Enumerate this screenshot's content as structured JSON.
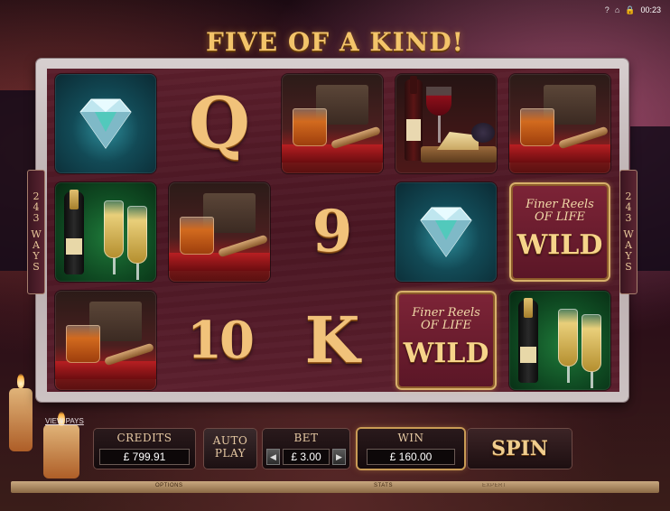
{
  "status_bar": {
    "time": "00:23"
  },
  "headline": "FIVE OF A KIND!",
  "ways": {
    "digits": [
      "2",
      "4",
      "3"
    ],
    "letters": [
      "W",
      "A",
      "Y",
      "S"
    ]
  },
  "reels": {
    "symbols": {
      "q": "Q",
      "nine": "9",
      "ten": "10",
      "k": "K"
    },
    "wild": {
      "subtitle_line1": "Finer Reels",
      "subtitle_line2": "OF LIFE",
      "word": "WILD"
    }
  },
  "controls": {
    "view_pays": "VIEW PAYS",
    "credits_label": "CREDITS",
    "credits_value": "£ 799.91",
    "autoplay_line1": "AUTO",
    "autoplay_line2": "PLAY",
    "bet_label": "BET",
    "bet_value": "£ 3.00",
    "bet_decrease": "◀",
    "bet_increase": "▶",
    "win_label": "WIN",
    "win_value": "£ 160.00",
    "spin_label": "SPIN"
  },
  "footer": {
    "options": "OPTIONS",
    "stats": "STATS",
    "expert": "EXPERT"
  },
  "colors": {
    "gold": "#f1c27a",
    "reel_bg": "#4a1623",
    "win_glow": "#c99b55"
  }
}
